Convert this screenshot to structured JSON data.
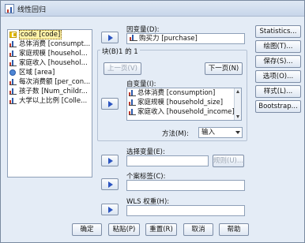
{
  "window": {
    "title": "线性回归"
  },
  "variables": [
    {
      "label": "code [code]",
      "icon": "ruler-icon",
      "selected": true
    },
    {
      "label": "总体消费 [consumpt...",
      "icon": "scale-icon"
    },
    {
      "label": "家庭规模 [househol...",
      "icon": "scale-icon"
    },
    {
      "label": "家庭收入 [househol...",
      "icon": "scale-icon"
    },
    {
      "label": "区域 [area]",
      "icon": "nominal-icon"
    },
    {
      "label": "每次消费额 [per_con...",
      "icon": "scale-icon"
    },
    {
      "label": "孩子数 [Num_childr...",
      "icon": "scale-icon"
    },
    {
      "label": "大学以上比例 [Colle...",
      "icon": "scale-icon"
    }
  ],
  "dependent": {
    "label": "因变量(D):",
    "value": "购买力 [purchase]"
  },
  "block": {
    "title": "块(B)1 的 1",
    "prev_label": "上一页(V)",
    "next_label": "下一页(N)",
    "independent_label": "自变量(I):",
    "independent_items": [
      "总体消费 [consumption]",
      "家庭规模 [household_size]",
      "家庭收入 [household_income]"
    ],
    "method_label": "方法(M):",
    "method_value": "输入"
  },
  "selection": {
    "label": "选择变量(E):",
    "rule_label": "规则(U)..."
  },
  "case_label": {
    "label": "个案标签(C):"
  },
  "wls": {
    "label": "WLS 权重(H):"
  },
  "side_buttons": [
    "Statistics...",
    "绘图(T)...",
    "保存(S)...",
    "选项(O)...",
    "样式(L)...",
    "Bootstrap..."
  ],
  "bottom_buttons": {
    "ok": "确定",
    "paste": "粘贴(P)",
    "reset": "重置(R)",
    "cancel": "取消",
    "help": "帮助"
  }
}
